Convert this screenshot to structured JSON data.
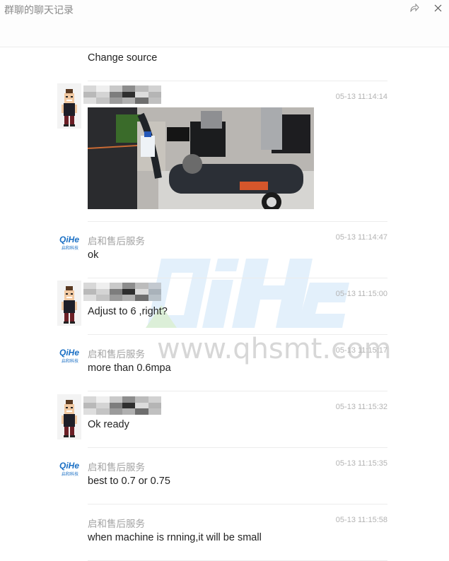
{
  "window": {
    "title": "群聊的聊天记录",
    "share_icon": "share-arrow-icon",
    "close_icon": "close-icon"
  },
  "watermark": {
    "logo_text": "QiHe",
    "url": "www.qhsmt.com"
  },
  "messages": [
    {
      "sender": "",
      "sender_blurred": false,
      "avatar": "none",
      "time": "",
      "text": "Change source",
      "type": "text"
    },
    {
      "sender": "",
      "sender_blurred": true,
      "avatar": "cartoon-man",
      "time": "05-13 11:14:14",
      "text": "",
      "type": "image",
      "image_alt": "Air compressor photo"
    },
    {
      "sender": "启和售后服务",
      "sender_blurred": false,
      "avatar": "qihe-logo",
      "time": "05-13 11:14:47",
      "text": "ok",
      "type": "text"
    },
    {
      "sender": "",
      "sender_blurred": true,
      "avatar": "cartoon-man",
      "time": "05-13 11:15:00",
      "text": "Adjust to 6 ,right?",
      "type": "text"
    },
    {
      "sender": "启和售后服务",
      "sender_blurred": false,
      "avatar": "qihe-logo",
      "time": "05-13 11:15:17",
      "text": "more than 0.6mpa",
      "type": "text"
    },
    {
      "sender": "",
      "sender_blurred": true,
      "avatar": "cartoon-man",
      "time": "05-13 11:15:32",
      "text": "Ok ready",
      "type": "text"
    },
    {
      "sender": "启和售后服务",
      "sender_blurred": false,
      "avatar": "qihe-logo",
      "time": "05-13 11:15:35",
      "text": "best to 0.7 or 0.75",
      "type": "text"
    },
    {
      "sender": "启和售后服务",
      "sender_blurred": false,
      "avatar": "none",
      "time": "05-13 11:15:58",
      "text": "when machine is rnning,it will be small",
      "type": "text"
    }
  ],
  "colors": {
    "logo_blue": "#1a6fc4",
    "watermark_blue": "#e3f0fb",
    "watermark_green": "#dcefd8"
  }
}
